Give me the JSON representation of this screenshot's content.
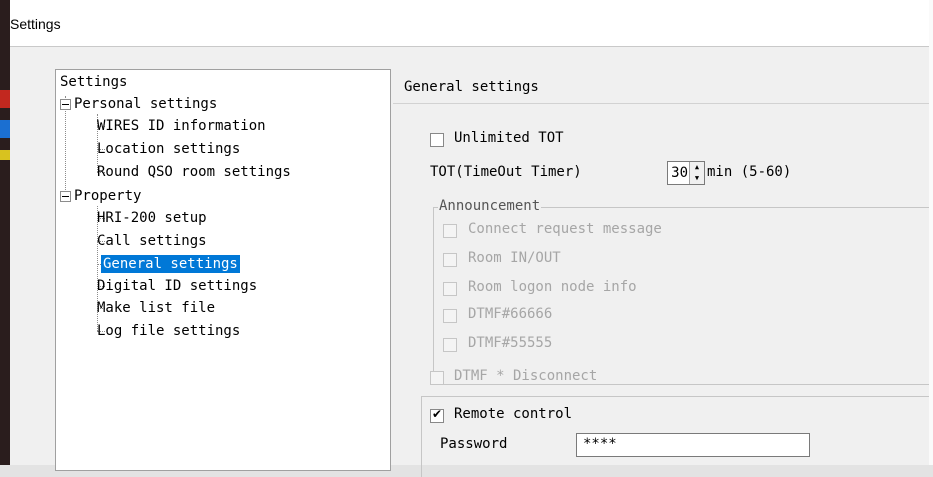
{
  "window": {
    "title": "Settings"
  },
  "tree": {
    "root": "Settings",
    "personal": {
      "label": "Personal settings",
      "children": [
        "WIRES ID information",
        "Location settings",
        "Round QSO room settings"
      ]
    },
    "property": {
      "label": "Property",
      "children": [
        "HRI-200 setup",
        "Call settings",
        "General settings",
        "Digital ID settings",
        "Make list file",
        "Log file settings"
      ]
    },
    "selected": "General settings"
  },
  "panel": {
    "title": "General settings",
    "unlimited_tot": {
      "label": "Unlimited TOT",
      "checked": false
    },
    "tot": {
      "label": "TOT(TimeOut Timer)",
      "value": "30",
      "unit": "min (5-60)"
    },
    "announcement": {
      "legend": "Announcement",
      "items": [
        {
          "label": "Connect request message",
          "checked": false,
          "enabled": false
        },
        {
          "label": "Room IN/OUT",
          "checked": false,
          "enabled": false
        },
        {
          "label": "Room logon node info",
          "checked": false,
          "enabled": false
        },
        {
          "label": "DTMF#66666",
          "checked": false,
          "enabled": false
        },
        {
          "label": "DTMF#55555",
          "checked": false,
          "enabled": false
        }
      ]
    },
    "dtmf_disconnect": {
      "label": "DTMF * Disconnect",
      "checked": false,
      "enabled": false
    },
    "remote_control": {
      "label": "Remote control",
      "checked": true
    },
    "password": {
      "label": "Password",
      "value": "****"
    }
  }
}
